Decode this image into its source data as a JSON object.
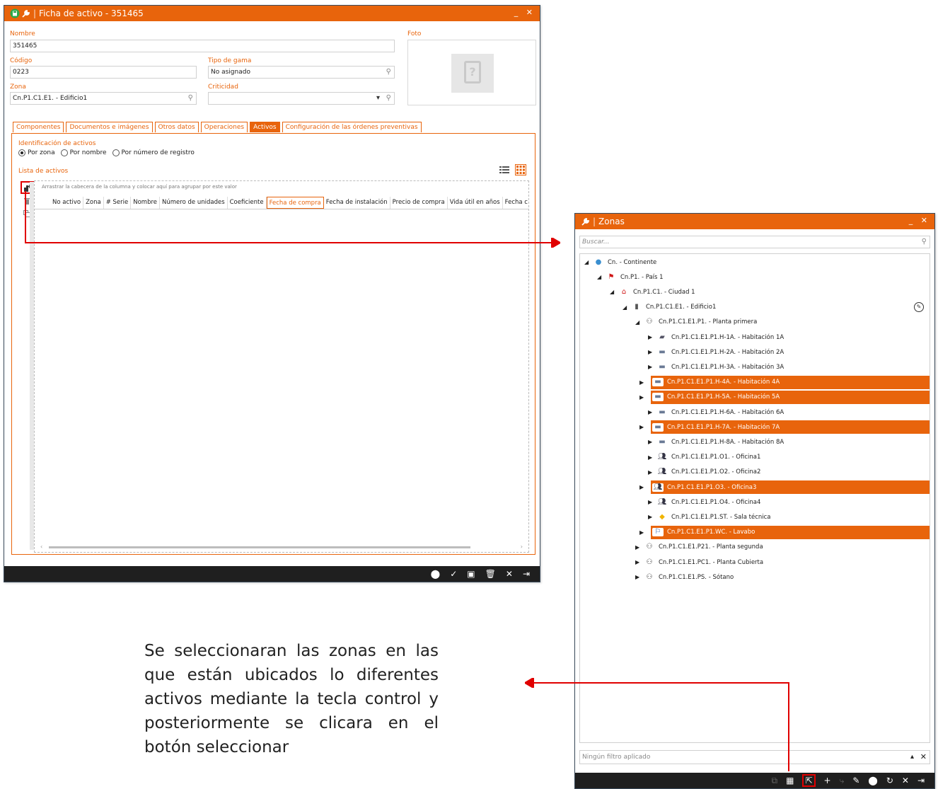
{
  "asset_window": {
    "title": "Ficha de activo - 351465",
    "fields": {
      "nombre": {
        "label": "Nombre",
        "value": "351465"
      },
      "codigo": {
        "label": "Código",
        "value": "0223"
      },
      "tipo_gama": {
        "label": "Tipo de gama",
        "value": "No asignado"
      },
      "zona": {
        "label": "Zona",
        "value": "Cn.P1.C1.E1. - Edificio1"
      },
      "criticidad": {
        "label": "Criticidad",
        "value": ""
      },
      "foto": {
        "label": "Foto"
      }
    },
    "tabs": [
      {
        "label": "Componentes"
      },
      {
        "label": "Documentos e imágenes"
      },
      {
        "label": "Otros datos"
      },
      {
        "label": "Operaciones"
      },
      {
        "label": "Activos"
      },
      {
        "label": "Configuración de las órdenes preventivas"
      }
    ],
    "identification": {
      "label": "Identificación de activos",
      "options": [
        "Por zona",
        "Por nombre",
        "Por número de registro"
      ],
      "selected": "Por zona"
    },
    "list": {
      "label": "Lista de activos",
      "group_hint": "Arrastrar la cabecera de la columna y colocar aquí para agrupar por este valor",
      "columns": [
        "No activo",
        "Zona",
        "# Serie",
        "Nombre",
        "Número de unidades",
        "Coeficiente",
        "Fecha de compra",
        "Fecha de instalación",
        "Precio de compra",
        "Vida útil en años",
        "Fecha c"
      ]
    },
    "toolbar_icons": [
      "print-icon",
      "check-icon",
      "save-icon",
      "trash-icon",
      "close-icon",
      "exit-icon"
    ]
  },
  "zones_window": {
    "title": "Zonas",
    "search_placeholder": "Buscar...",
    "tree": [
      {
        "label": "Cn. - Continente",
        "indent": 0,
        "expanded": true,
        "icon": "globe-icon",
        "selected": false
      },
      {
        "label": "Cn.P1. - País 1",
        "indent": 1,
        "expanded": true,
        "icon": "flag-icon",
        "selected": false
      },
      {
        "label": "Cn.P1.C1. - Ciudad 1",
        "indent": 2,
        "expanded": true,
        "icon": "house-icon",
        "selected": false
      },
      {
        "label": "Cn.P1.C1.E1. - Edificio1",
        "indent": 3,
        "expanded": true,
        "icon": "building-icon",
        "selected": false
      },
      {
        "label": "Cn.P1.C1.E1.P1. - Planta primera",
        "indent": 4,
        "expanded": true,
        "icon": "floor-icon",
        "selected": false
      },
      {
        "label": "Cn.P1.C1.E1.P1.H-1A. - Habitación 1A",
        "indent": 5,
        "expanded": false,
        "icon": "room-icon",
        "selected": false
      },
      {
        "label": "Cn.P1.C1.E1.P1.H-2A. - Habitación 2A",
        "indent": 5,
        "expanded": false,
        "icon": "bed-icon",
        "selected": false
      },
      {
        "label": "Cn.P1.C1.E1.P1.H-3A. - Habitación 3A",
        "indent": 5,
        "expanded": false,
        "icon": "bed-icon",
        "selected": false
      },
      {
        "label": "Cn.P1.C1.E1.P1.H-4A. - Habitación 4A",
        "indent": 5,
        "expanded": false,
        "icon": "bed-icon",
        "selected": true
      },
      {
        "label": "Cn.P1.C1.E1.P1.H-5A. - Habitación 5A",
        "indent": 5,
        "expanded": false,
        "icon": "bed-icon",
        "selected": true
      },
      {
        "label": "Cn.P1.C1.E1.P1.H-6A. - Habitación 6A",
        "indent": 5,
        "expanded": false,
        "icon": "bed-icon",
        "selected": false
      },
      {
        "label": "Cn.P1.C1.E1.P1.H-7A. - Habitación 7A",
        "indent": 5,
        "expanded": false,
        "icon": "bed-icon",
        "selected": true
      },
      {
        "label": "Cn.P1.C1.E1.P1.H-8A. - Habitación 8A",
        "indent": 5,
        "expanded": false,
        "icon": "bed-icon",
        "selected": false
      },
      {
        "label": "Cn.P1.C1.E1.P1.O1. - Oficina1",
        "indent": 5,
        "expanded": false,
        "icon": "people-icon",
        "selected": false
      },
      {
        "label": "Cn.P1.C1.E1.P1.O2. - Oficina2",
        "indent": 5,
        "expanded": false,
        "icon": "people-icon",
        "selected": false
      },
      {
        "label": "Cn.P1.C1.E1.P1.O3. - Oficina3",
        "indent": 5,
        "expanded": false,
        "icon": "people-icon",
        "selected": true
      },
      {
        "label": "Cn.P1.C1.E1.P1.O4. - Oficina4",
        "indent": 5,
        "expanded": false,
        "icon": "people-icon",
        "selected": false
      },
      {
        "label": "Cn.P1.C1.E1.P1.ST. - Sala técnica",
        "indent": 5,
        "expanded": false,
        "icon": "warning-icon",
        "selected": false
      },
      {
        "label": "Cn.P1.C1.E1.P1.WC. - Lavabo",
        "indent": 5,
        "expanded": false,
        "icon": "wc-icon",
        "selected": true
      },
      {
        "label": "Cn.P1.C1.E1.P21. - Planta segunda",
        "indent": 4,
        "expanded": false,
        "icon": "floor-icon",
        "selected": false
      },
      {
        "label": "Cn.P1.C1.E1.PC1. - Planta Cubierta",
        "indent": 4,
        "expanded": false,
        "icon": "floor-icon",
        "selected": false
      },
      {
        "label": "Cn.P1.C1.E1.PS. - Sótano",
        "indent": 4,
        "expanded": false,
        "icon": "floor-icon",
        "selected": false
      }
    ],
    "filter_text": "Ningún filtro aplicado",
    "toolbar_icons": [
      "copy-icon",
      "qr-icon",
      "select-icon",
      "add-icon",
      "link-icon",
      "edit-icon",
      "print-icon",
      "refresh-icon",
      "close-icon",
      "exit-icon"
    ]
  },
  "annotation": "Se seleccionaran las zonas en las que están ubicados lo diferentes activos mediante la tecla control y posteriormente se clicara en el botón seleccionar",
  "colors": {
    "accent": "#e8640c",
    "dark_toolbar": "#1f1f1f",
    "callout": "#e00000"
  }
}
